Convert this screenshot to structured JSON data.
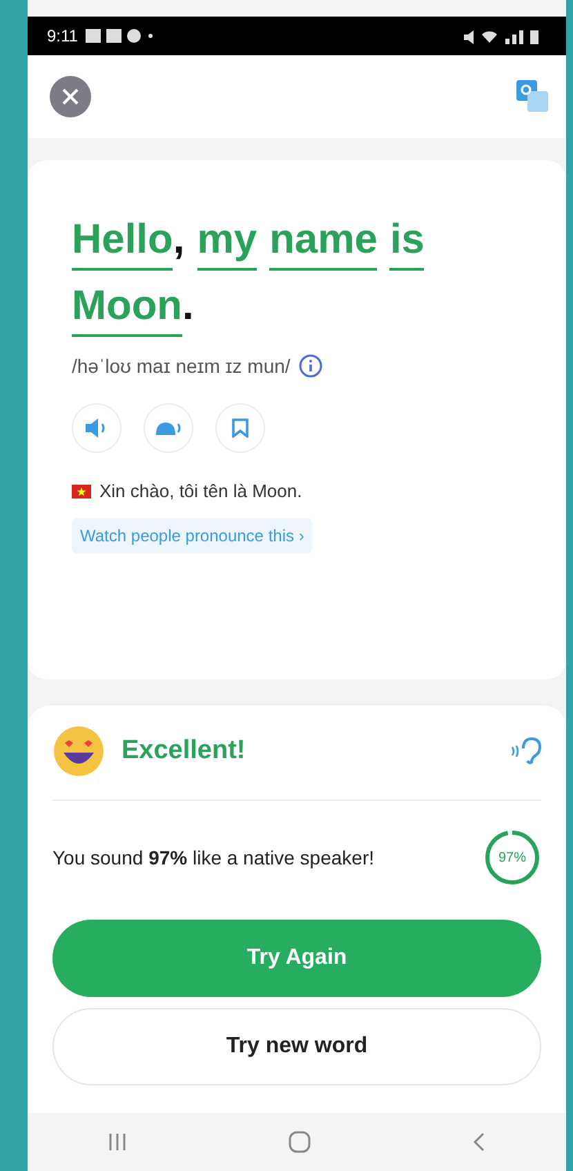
{
  "status_bar": {
    "time": "9:11"
  },
  "sentence": [
    {
      "text": "Hello",
      "kind": "word"
    },
    {
      "text": ",",
      "kind": "punct"
    },
    {
      "text": "my",
      "kind": "word"
    },
    {
      "text": "name",
      "kind": "word"
    },
    {
      "text": "is",
      "kind": "word"
    },
    {
      "text": "Moon",
      "kind": "word"
    },
    {
      "text": ".",
      "kind": "punct"
    }
  ],
  "phonetic": "/həˈloʊ maɪ neɪm ɪz mun/",
  "translation": "Xin chào, tôi tên là Moon.",
  "watch_link": "Watch people pronounce this ›",
  "result": {
    "title": "Excellent!",
    "message": "You sound **97%** like a native speaker!",
    "score": "97%",
    "level": 0.97
  },
  "buttons": [
    {
      "label": "Try Again",
      "kind": "primary"
    },
    {
      "label": "Try new word",
      "kind": "secondary"
    }
  ]
}
